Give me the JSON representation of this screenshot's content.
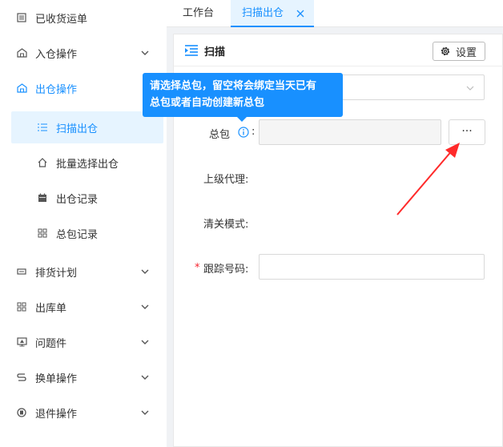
{
  "sidebar": {
    "items": [
      {
        "label": "已收货运单",
        "icon": "document-list-icon"
      },
      {
        "label": "入仓操作",
        "icon": "warehouse-in-icon"
      },
      {
        "label": "出仓操作",
        "icon": "warehouse-out-icon"
      },
      {
        "label": "排货计划",
        "icon": "plan-icon"
      },
      {
        "label": "出库单",
        "icon": "grid-icon"
      },
      {
        "label": "问题件",
        "icon": "monitor-icon"
      },
      {
        "label": "换单操作",
        "icon": "swap-icon"
      },
      {
        "label": "退件操作",
        "icon": "return-icon"
      }
    ],
    "sub_items": [
      {
        "label": "扫描出仓",
        "icon": "scan-list-icon"
      },
      {
        "label": "批量选择出仓",
        "icon": "home-icon"
      },
      {
        "label": "出仓记录",
        "icon": "calendar-icon"
      },
      {
        "label": "总包记录",
        "icon": "grid-icon"
      }
    ]
  },
  "tabs": {
    "workbench": "工作台",
    "scan_out": "扫描出仓"
  },
  "panel": {
    "title": "扫描",
    "settings_label": "设置"
  },
  "form": {
    "bag_label": "总包",
    "colon": ":",
    "more_label": "···",
    "agent_label": "上级代理:",
    "clearance_label": "清关模式:",
    "required_mark": "*",
    "tracking_label": "跟踪号码:"
  },
  "tooltip": {
    "line1": "请选择总包，留空将会绑定当天已有",
    "line2": "总包或者自动创建新总包"
  },
  "colors": {
    "accent": "#1890ff",
    "required": "#f5222d",
    "arrow": "#ff2a2a"
  }
}
